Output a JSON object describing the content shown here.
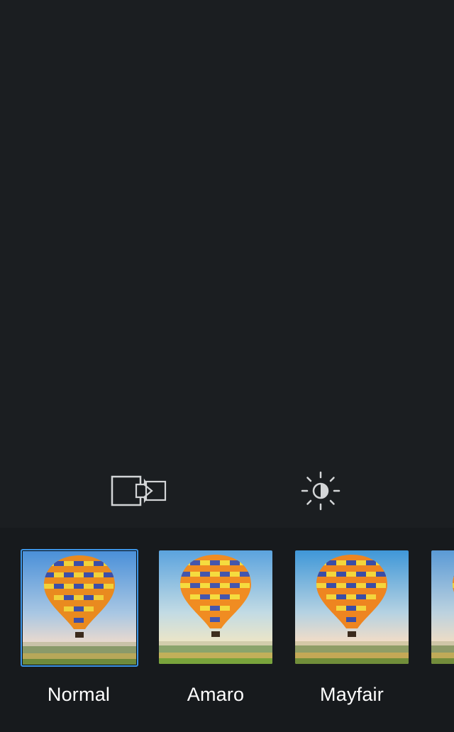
{
  "toolbar": {
    "border_tool_icon": "border-toggle-icon",
    "lux_tool_icon": "lux-brightness-icon"
  },
  "filters": [
    {
      "label": "Normal",
      "selected": true
    },
    {
      "label": "Amaro",
      "selected": false
    },
    {
      "label": "Mayfair",
      "selected": false
    },
    {
      "label": "",
      "selected": false
    }
  ],
  "colors": {
    "background": "#1b1e21",
    "strip": "#171a1d",
    "selection": "#3d95e6",
    "label": "#ffffff"
  }
}
